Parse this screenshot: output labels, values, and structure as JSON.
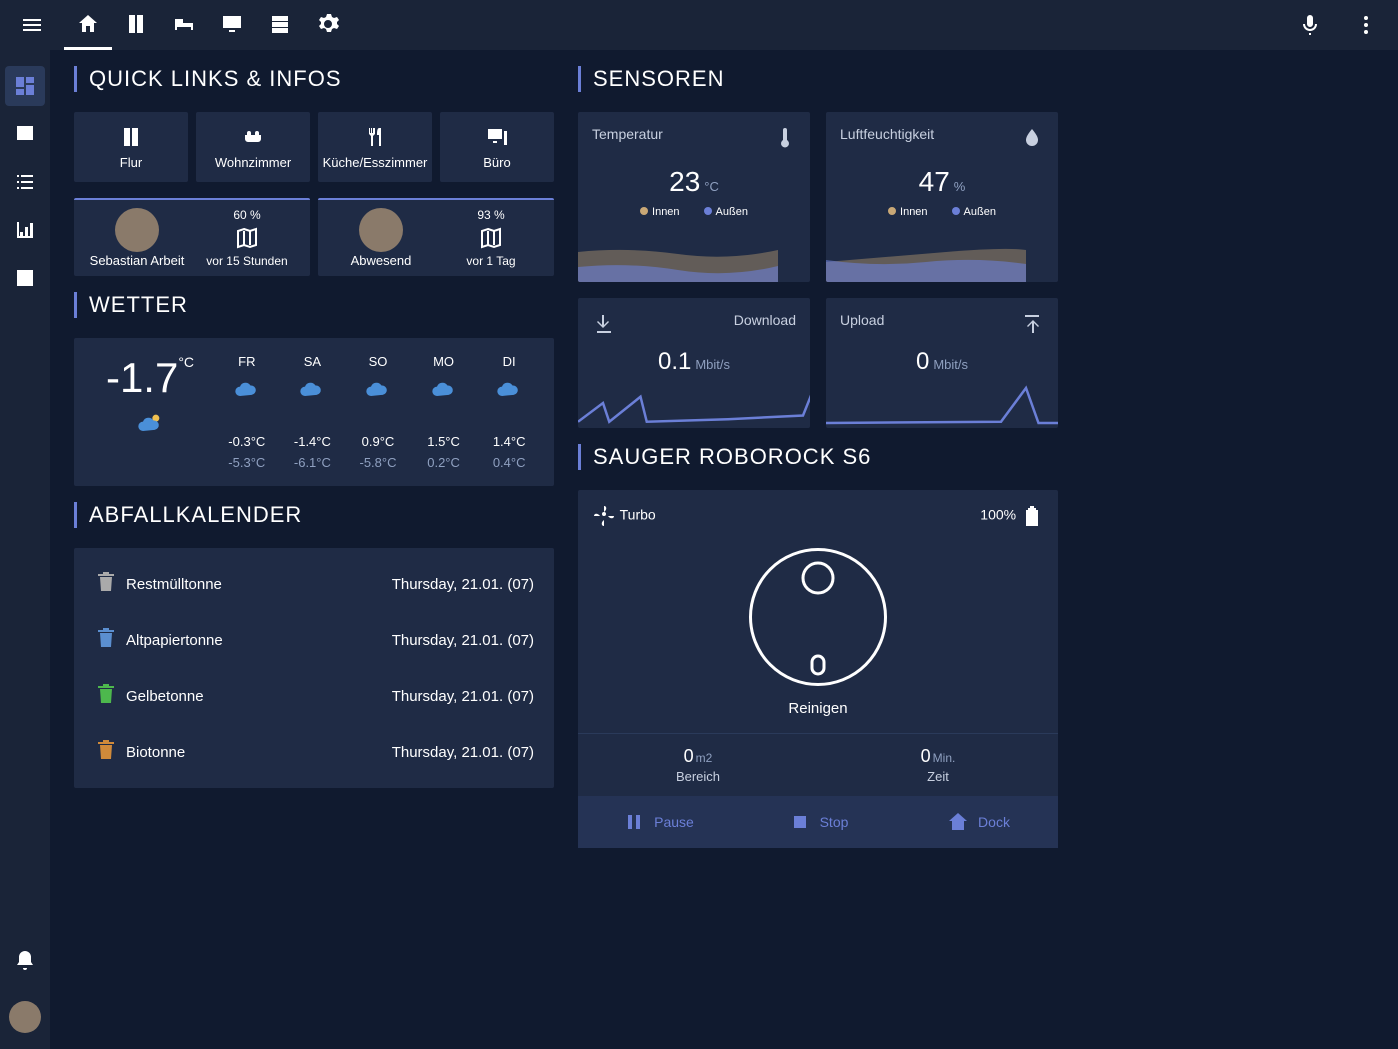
{
  "sections": {
    "quicklinks": "QUICK LINKS & INFOS",
    "wetter": "WETTER",
    "abfall": "ABFALLKALENDER",
    "sensoren": "SENSOREN",
    "sauger": "SAUGER ROBOROCK S6"
  },
  "quicklinks": [
    {
      "label": "Flur"
    },
    {
      "label": "Wohnzimmer"
    },
    {
      "label": "Küche/Esszimmer"
    },
    {
      "label": "Büro"
    }
  ],
  "persons": [
    {
      "name": "Sebastian Arbeit",
      "battery": "60 %",
      "time": "vor 15 Stunden"
    },
    {
      "name": "Abwesend",
      "battery": "93 %",
      "time": "vor 1 Tag"
    }
  ],
  "weather": {
    "now_temp": "-1.7",
    "now_unit": "°C",
    "days": [
      {
        "d": "FR",
        "hi": "-0.3°C",
        "lo": "-5.3°C"
      },
      {
        "d": "SA",
        "hi": "-1.4°C",
        "lo": "-6.1°C"
      },
      {
        "d": "SO",
        "hi": "0.9°C",
        "lo": "-5.8°C"
      },
      {
        "d": "MO",
        "hi": "1.5°C",
        "lo": "0.2°C"
      },
      {
        "d": "DI",
        "hi": "1.4°C",
        "lo": "0.4°C"
      }
    ]
  },
  "abfall": [
    {
      "name": "Restmülltonne",
      "date": "Thursday, 21.01. (07)"
    },
    {
      "name": "Altpapiertonne",
      "date": "Thursday, 21.01. (07)"
    },
    {
      "name": "Gelbetonne",
      "date": "Thursday, 21.01. (07)"
    },
    {
      "name": "Biotonne",
      "date": "Thursday, 21.01. (07)"
    }
  ],
  "sensors": {
    "temp": {
      "label": "Temperatur",
      "value": "23",
      "unit": "°C",
      "legend_a": "Innen",
      "legend_b": "Außen"
    },
    "hum": {
      "label": "Luftfeuchtigkeit",
      "value": "47",
      "unit": "%",
      "legend_a": "Innen",
      "legend_b": "Außen"
    },
    "down": {
      "label": "Download",
      "value": "0.1",
      "unit": "Mbit/s"
    },
    "up": {
      "label": "Upload",
      "value": "0",
      "unit": "Mbit/s"
    }
  },
  "vacuum": {
    "mode": "Turbo",
    "battery": "100%",
    "status": "Reinigen",
    "area_v": "0",
    "area_u": "m2",
    "area_l": "Bereich",
    "time_v": "0",
    "time_u": "Min.",
    "time_l": "Zeit",
    "actions": {
      "pause": "Pause",
      "stop": "Stop",
      "dock": "Dock"
    }
  }
}
